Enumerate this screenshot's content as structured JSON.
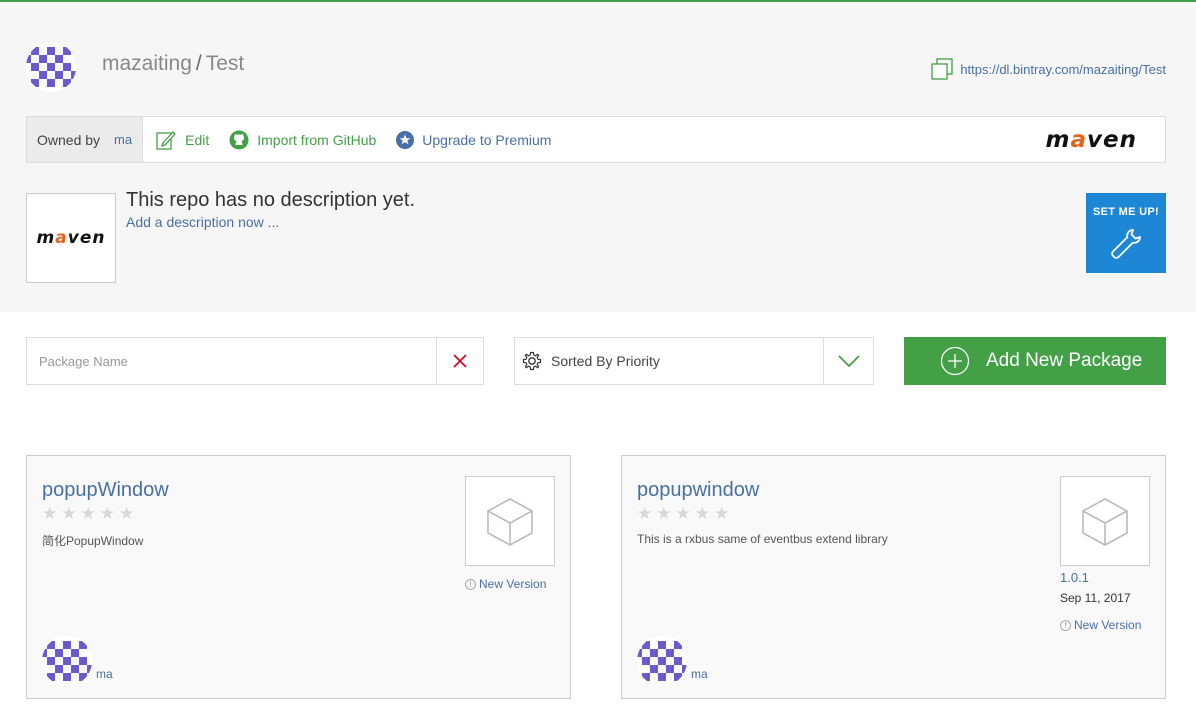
{
  "header": {
    "owner": "mazaiting",
    "separator": "/",
    "repo": "Test",
    "download_url": "https://dl.bintray.com/mazaiting/Test"
  },
  "toolbar": {
    "owned_by_label": "Owned by",
    "owner_short": "ma",
    "edit_label": "Edit",
    "import_label": "Import from GitHub",
    "upgrade_label": "Upgrade to Premium",
    "logo_text_pre": "m",
    "logo_text_accent": "a",
    "logo_text_post": "ven"
  },
  "description": {
    "title": "This repo has no description yet.",
    "add_link": "Add a description now ..."
  },
  "setup": {
    "label": "SET ME UP!"
  },
  "filters": {
    "search_placeholder": "Package Name",
    "sort_label": "Sorted By Priority",
    "add_package_label": "Add New Package"
  },
  "packages": [
    {
      "name": "popupWindow",
      "rating": 0,
      "description": "简化PopupWindow",
      "version": "",
      "date": "",
      "new_version_label": "New Version",
      "owner": "ma"
    },
    {
      "name": "popupwindow",
      "rating": 0,
      "description": "This is a rxbus same of eventbus extend library",
      "version": "1.0.1",
      "date": "Sep 11, 2017",
      "new_version_label": "New Version",
      "owner": "ma"
    }
  ],
  "colors": {
    "accent_green": "#43a047",
    "link_blue": "#4a6fa5",
    "setup_blue": "#1d87d5",
    "avatar_purple": "#6a5acd",
    "clear_red": "#d0021b"
  },
  "icons": [
    "copy-icon",
    "edit-icon",
    "github-icon",
    "star-icon",
    "wrench-icon",
    "close-icon",
    "gear-icon",
    "chevron-down-icon",
    "plus-circle-icon",
    "package-box-icon",
    "info-icon"
  ]
}
